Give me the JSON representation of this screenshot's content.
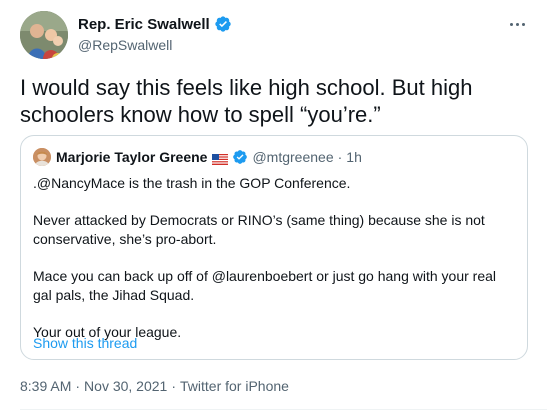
{
  "tweet": {
    "author_name": "Rep. Eric Swalwell",
    "author_handle": "@RepSwalwell",
    "text": "I would say this feels like high school. But high schoolers know how to spell “you’re.”",
    "icons": {
      "verified": "verified-badge-icon",
      "more": "more-options-icon"
    },
    "colors": {
      "accent": "#1d9bf0",
      "muted": "#536471",
      "text": "#0f1419",
      "border": "#cfd9de"
    }
  },
  "quote": {
    "author_name": "Marjorie Taylor Greene",
    "flag": "us-flag-icon",
    "author_handle": "@mtgreenee",
    "separator": "·",
    "time": "1h",
    "paragraphs": [
      ".@NancyMace is the trash in the GOP Conference.",
      "Never attacked by Democrats or RINO’s (same thing) because she is not conservative, she’s pro-abort.",
      "Mace you can back up off of @laurenboebert or just go hang with your real gal pals, the Jihad Squad.",
      "Your out of your league."
    ],
    "show_thread": "Show this thread"
  },
  "meta": {
    "time": "8:39 AM",
    "separator": "·",
    "date": "Nov 30, 2021",
    "source": "Twitter for iPhone"
  }
}
